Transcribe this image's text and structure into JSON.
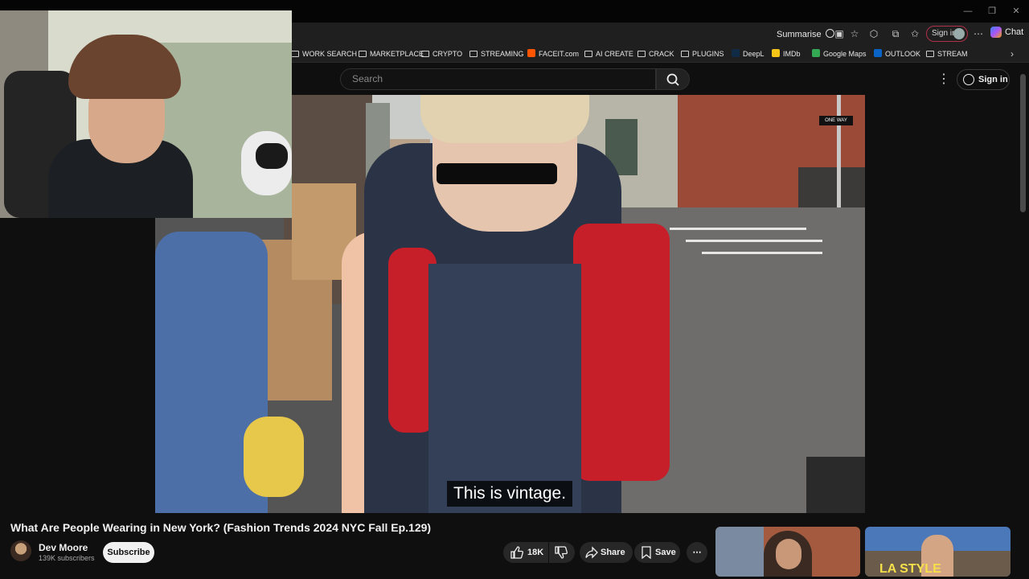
{
  "browser": {
    "summarise_label": "Summarise",
    "signin_label": "Sign in",
    "chat_label": "Chat",
    "bookmarks": [
      {
        "label": "WORK SEARCH",
        "icon": "folder-icon"
      },
      {
        "label": "MARKETPLACE",
        "icon": "folder-icon"
      },
      {
        "label": "CRYPTO",
        "icon": "folder-icon"
      },
      {
        "label": "STREAMING",
        "icon": "folder-icon"
      },
      {
        "label": "FACEIT.com",
        "icon": "faceit-icon"
      },
      {
        "label": "AI CREATE",
        "icon": "folder-icon"
      },
      {
        "label": "CRACK",
        "icon": "folder-icon"
      },
      {
        "label": "PLUGINS",
        "icon": "folder-icon"
      },
      {
        "label": "DeepL",
        "icon": "deepl-icon"
      },
      {
        "label": "IMDb",
        "icon": "imdb-icon"
      },
      {
        "label": "Google Maps",
        "icon": "google-maps-icon"
      },
      {
        "label": "OUTLOOK",
        "icon": "outlook-icon"
      },
      {
        "label": "STREAM",
        "icon": "folder-icon"
      }
    ]
  },
  "youtube": {
    "search_placeholder": "Search",
    "signin_label": "Sign in",
    "caption": "This is vintage.",
    "video_title": "What Are People Wearing in New York? (Fashion Trends 2024 NYC Fall Ep.129)",
    "channel_name": "Dev Moore",
    "subscribers": "139K subscribers",
    "subscribe_label": "Subscribe",
    "like_count": "18K",
    "share_label": "Share",
    "save_label": "Save",
    "thumbnails": [
      {
        "text": ""
      },
      {
        "text": "LA STYLE"
      }
    ],
    "street_sign": "ONE WAY"
  },
  "colors": {
    "page_bg": "#0f0f0f",
    "pill_bg": "#272727",
    "subscribe_bg": "#f1f1f1",
    "signin_pill_border": "#b0304a"
  }
}
